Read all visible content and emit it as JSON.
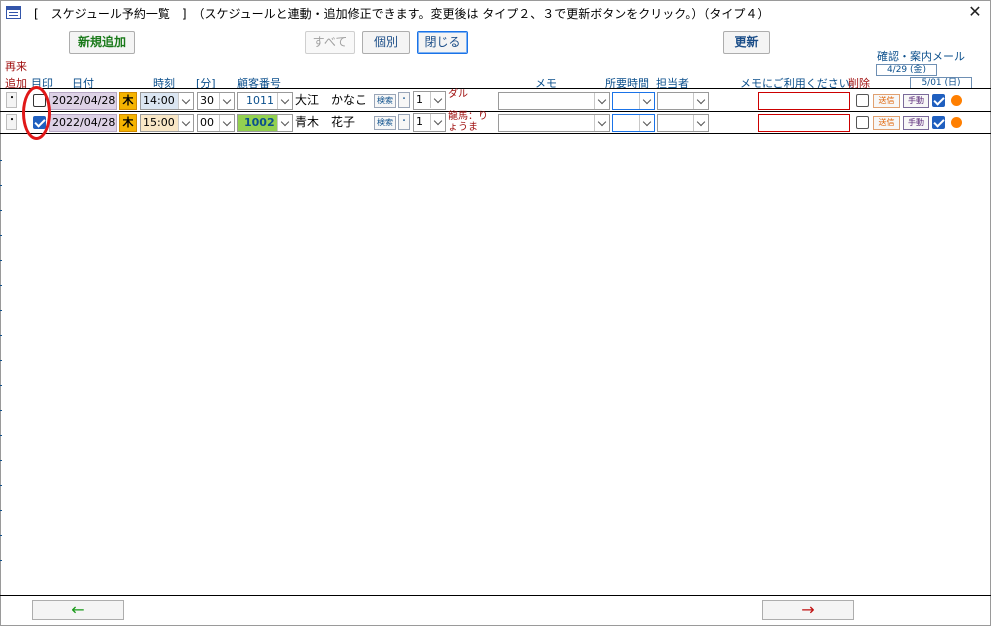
{
  "window": {
    "title": "[　スケジュール予約一覧　]　（スケジュールと連動・追加修正できます。変更後は タイプ２、３で更新ボタンをクリック。）（タイプ４）",
    "close_glyph": "✕"
  },
  "toolbar": {
    "new_label": "新規追加",
    "all_label": "すべて",
    "individual_label": "個別",
    "close_label": "閉じる",
    "update_label": "更新"
  },
  "mail_header": {
    "title": "確認・案内メール",
    "date1": "4/29 (金)",
    "date2": "5/01 (日)"
  },
  "columns": {
    "revisit_line1": "再来",
    "revisit_line2": "追加",
    "mark": "目印",
    "date": "日付",
    "time": "時刻",
    "min": "[分]",
    "customer_no": "顧客番号",
    "memo": "メモ",
    "duration": "所要時間",
    "staff": "担当者",
    "memo_hint": "メモにご利用ください。",
    "delete": "削除"
  },
  "rows": [
    {
      "dot": "・",
      "marked": false,
      "date": "2022/04/28",
      "day": "木",
      "hour": "14:00",
      "minute": "30",
      "customer_no": "1011",
      "name": "大江　かなこ",
      "search": "検索",
      "dot2": "・",
      "count": "1",
      "note": "ダル",
      "send": "送信",
      "manual": "手動",
      "mail_checked": true
    },
    {
      "dot": "・",
      "marked": true,
      "date": "2022/04/28",
      "day": "木",
      "hour": "15:00",
      "minute": "00",
      "customer_no": "1002",
      "name": "青木　花子",
      "search": "検索",
      "dot2": "・",
      "count": "1",
      "note": "龍馬：りょうま",
      "send": "送信",
      "manual": "手動",
      "mail_checked": true
    }
  ],
  "footer": {
    "prev_glyph": "←",
    "next_glyph": "→",
    "prev_color": "#1a9a1a",
    "next_color": "#c01010"
  }
}
